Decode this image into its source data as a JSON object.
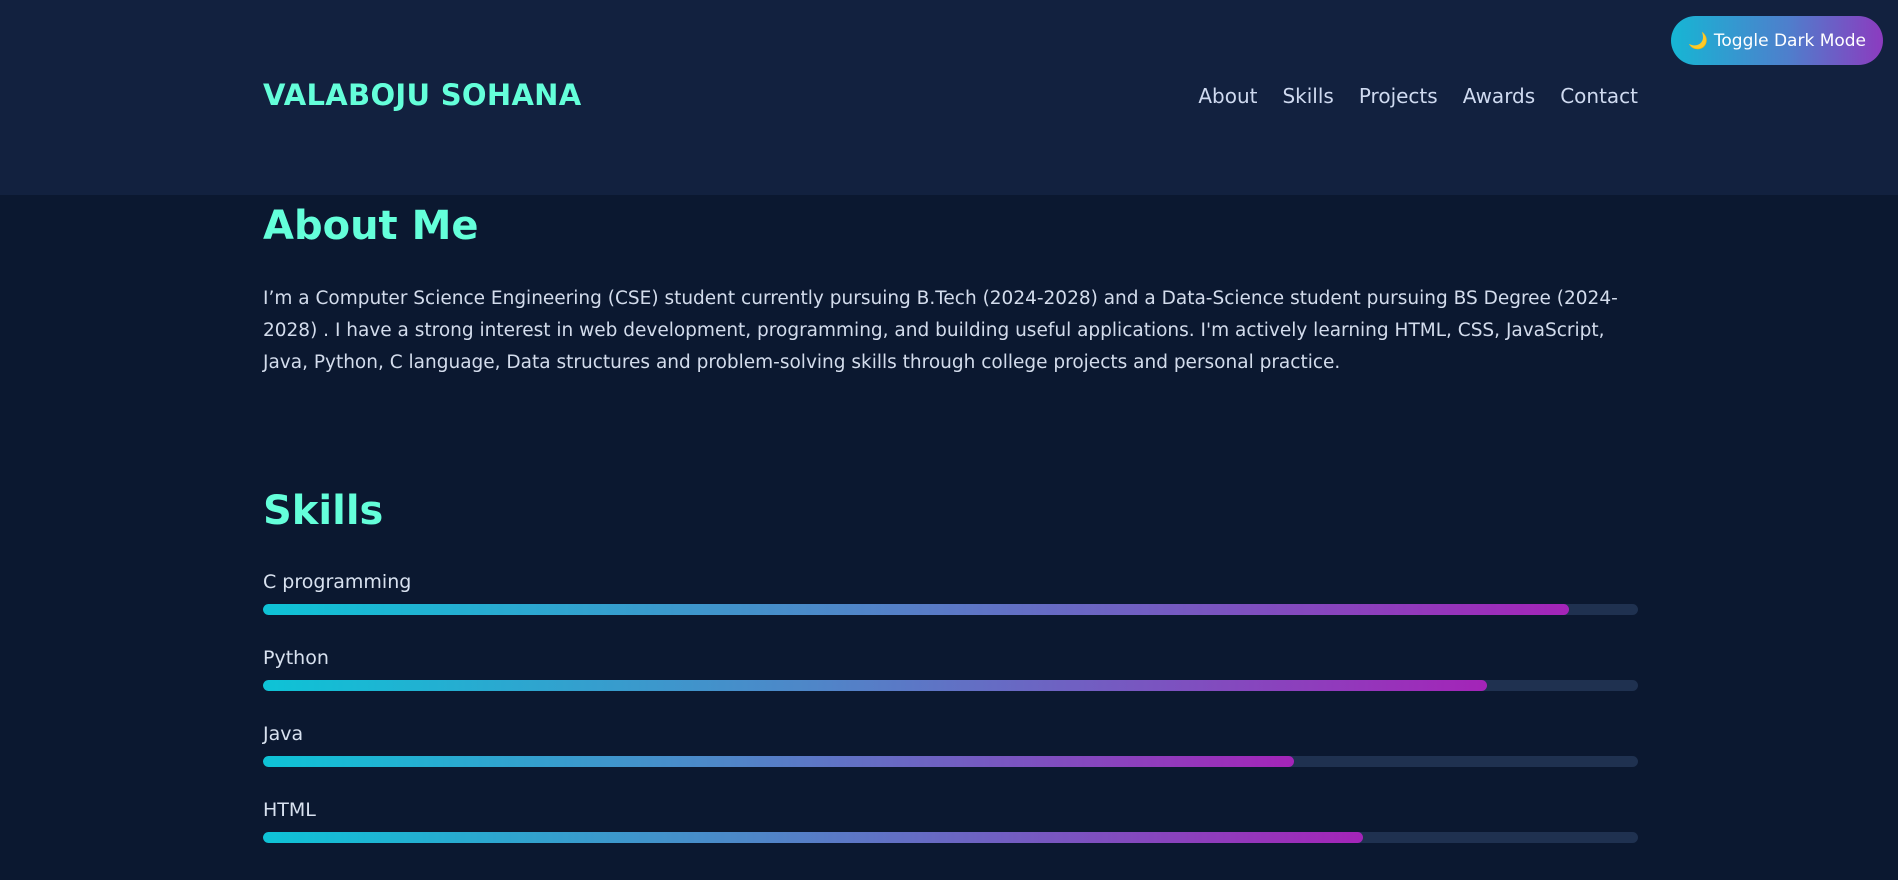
{
  "header": {
    "brand": "VALABOJU SOHANA",
    "nav": [
      "About",
      "Skills",
      "Projects",
      "Awards",
      "Contact"
    ]
  },
  "toggle": {
    "icon": "moon-icon",
    "icon_glyph": "🌙",
    "label": "Toggle Dark Mode"
  },
  "about": {
    "title": "About Me",
    "text": "I’m a Computer Science Engineering (CSE) student currently pursuing B.Tech (2024-2028) and a Data-Science student pursuing BS Degree (2024-2028) . I have a strong interest in web development, programming, and building useful applications. I'm actively learning HTML, CSS, JavaScript, Java, Python, C language, Data structures and problem-solving skills through college projects and personal practice."
  },
  "skills": {
    "title": "Skills",
    "items": [
      {
        "name": "C programming",
        "level": 0.95
      },
      {
        "name": "Python",
        "level": 0.89
      },
      {
        "name": "Java",
        "level": 0.75
      },
      {
        "name": "HTML",
        "level": 0.8
      }
    ]
  },
  "colors": {
    "background": "#0b1830",
    "header": "#12213f",
    "accent": "#64ffda",
    "bar_track": "#1f3150"
  }
}
